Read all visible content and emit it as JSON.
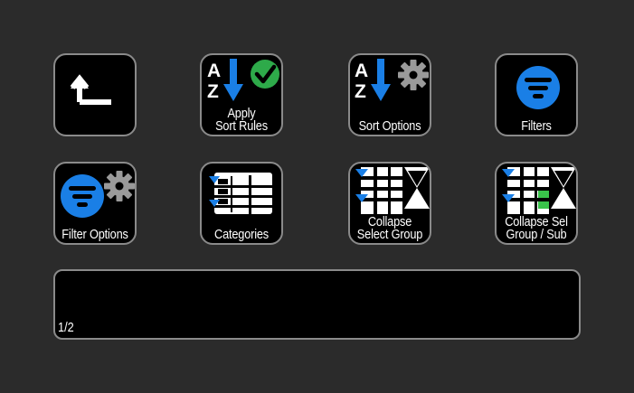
{
  "buttons": {
    "back": {
      "label": ""
    },
    "apply_sort_rules": {
      "line1": "Apply",
      "line2": "Sort Rules"
    },
    "sort_options": {
      "line1": "Sort Options"
    },
    "filters": {
      "line1": "Filters"
    },
    "filter_options": {
      "line1": "Filter Options"
    },
    "categories": {
      "line1": "Categories"
    },
    "collapse_select_group": {
      "line1": "Collapse",
      "line2": "Select Group"
    },
    "collapse_sel_group_sub": {
      "line1": "Collapse Sel",
      "line2": "Group / Sub"
    }
  },
  "pager": {
    "text": "1/2"
  },
  "colors": {
    "background": "#2b2b2b",
    "key_fill": "#000000",
    "key_border": "#8a8a8a",
    "accent_blue": "#1a7fe6",
    "check_green": "#2eaa4a",
    "gear_gray": "#9a9a9a",
    "highlight_green": "#39c24a"
  }
}
